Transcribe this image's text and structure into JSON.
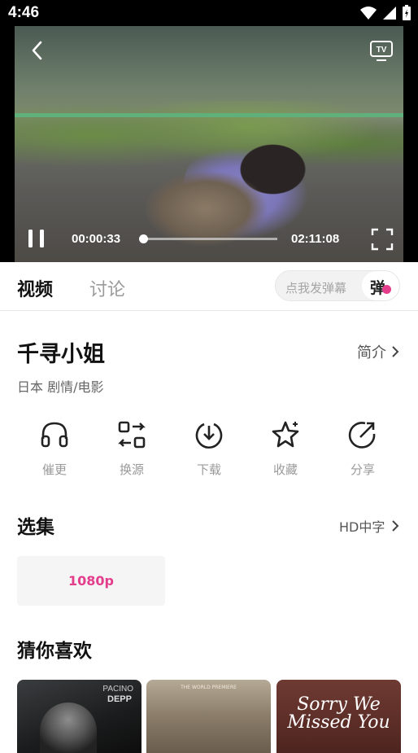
{
  "status_bar": {
    "time": "4:46"
  },
  "player": {
    "current_time": "00:00:33",
    "total_time": "02:11:08",
    "progress": 0.005
  },
  "tabs": {
    "video": "视频",
    "discussion": "讨论"
  },
  "danmaku": {
    "placeholder": "点我发弹幕",
    "toggle_label": "弹"
  },
  "movie": {
    "title": "千寻小姐",
    "intro_link": "简介",
    "meta": "日本  剧情/电影"
  },
  "actions": [
    {
      "label": "催更",
      "icon": "headphones-icon"
    },
    {
      "label": "换源",
      "icon": "switch-source-icon"
    },
    {
      "label": "下载",
      "icon": "download-icon"
    },
    {
      "label": "收藏",
      "icon": "star-icon"
    },
    {
      "label": "分享",
      "icon": "share-icon"
    }
  ],
  "episodes": {
    "title": "选集",
    "quality": "HD中字",
    "items": [
      "1080p"
    ]
  },
  "recommend": {
    "title": "猜你喜欢",
    "posters": [
      {
        "line1": "PACINO",
        "line2": "DEPP"
      },
      {
        "line1": "THE WORLD PREMIERE"
      },
      {
        "title_line1": "Sorry We",
        "title_line2": "Missed You"
      }
    ]
  },
  "colors": {
    "accent": "#e33d8c",
    "text_primary": "#111111",
    "text_secondary": "#9a9a9a"
  }
}
